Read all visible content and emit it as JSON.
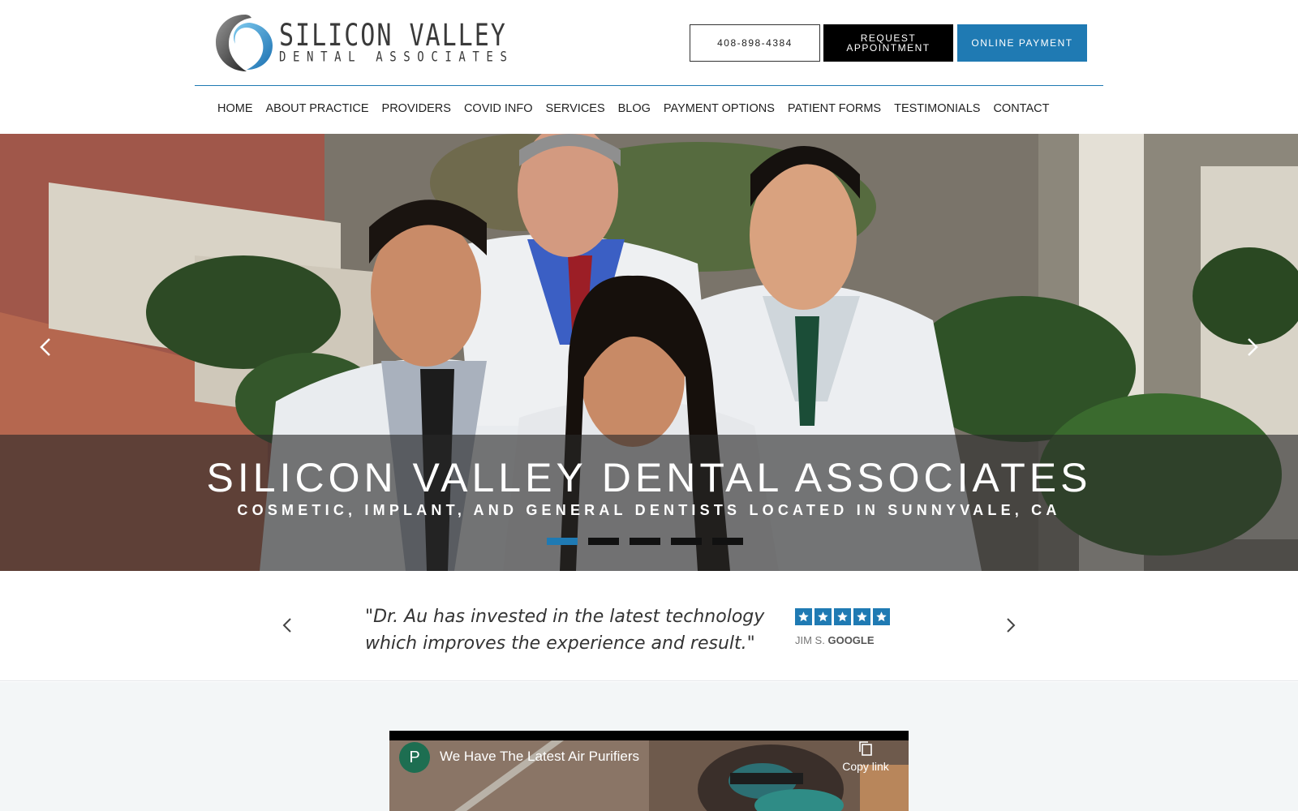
{
  "header": {
    "logo": {
      "line1": "SILICON VALLEY",
      "line2": "DENTAL ASSOCIATES"
    },
    "phone_label": "408-898-4384",
    "request_label": "Request Appointment",
    "payment_label": "Online Payment"
  },
  "nav": {
    "items": [
      {
        "label": "Home"
      },
      {
        "label": "About Practice"
      },
      {
        "label": "Providers"
      },
      {
        "label": "Covid Info"
      },
      {
        "label": "Services"
      },
      {
        "label": "Blog"
      },
      {
        "label": "Payment Options"
      },
      {
        "label": "Patient Forms"
      },
      {
        "label": "Testimonials"
      },
      {
        "label": "Contact"
      }
    ]
  },
  "hero": {
    "title": "SILICON VALLEY DENTAL ASSOCIATES",
    "subtitle": "Cosmetic, Implant, and General Dentists Located in Sunnyvale, CA",
    "slide_count": 5,
    "active_slide": 1
  },
  "testimonial": {
    "quote": "\"Dr. Au has invested in the latest technology which improves the experience and result.\"",
    "rating": 5,
    "author": "JIM S.",
    "source": "GOOGLE"
  },
  "video": {
    "channel_initial": "P",
    "title": "We Have The Latest Air Purifiers",
    "copy_label": "Copy link"
  },
  "colors": {
    "accent": "#1f7ab3",
    "black_button": "#000000",
    "lower_bg": "#f3f6f7"
  }
}
